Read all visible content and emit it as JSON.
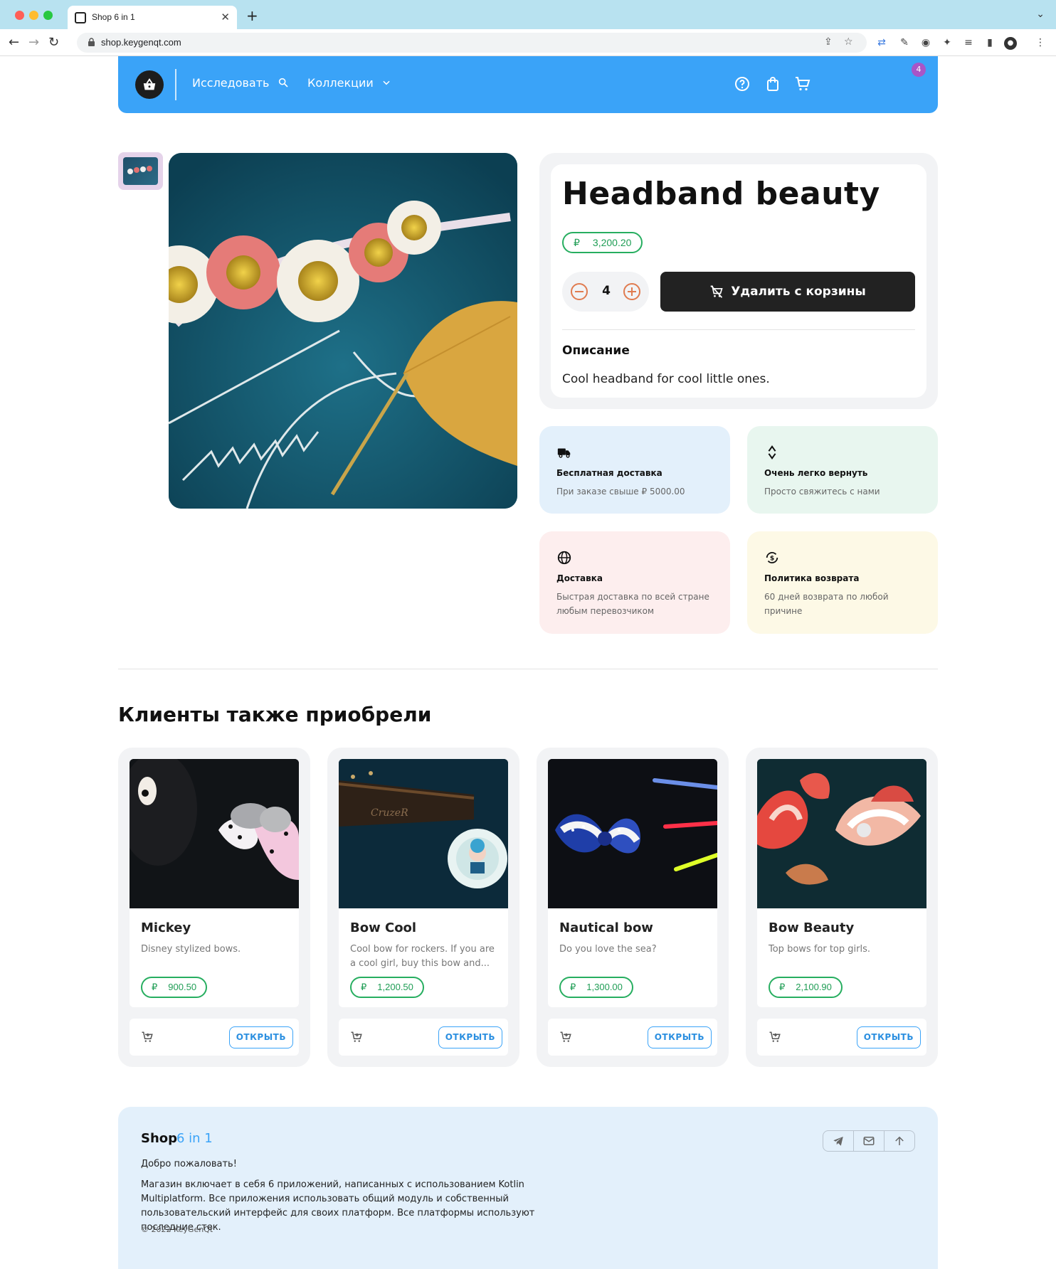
{
  "browser": {
    "tab_title": "Shop 6 in 1",
    "url": "shop.keygenqt.com"
  },
  "header": {
    "explore": "Исследовать",
    "collections": "Коллекции",
    "cart_count": "4",
    "accent": "#3aa3f8"
  },
  "product": {
    "title": "Headband beauty",
    "currency": "₽",
    "price": "3,200.20",
    "quantity": "4",
    "remove_label": "Удалить с корзины",
    "description_title": "Описание",
    "description": "Cool headband for cool little ones."
  },
  "features": [
    {
      "icon": "truck-icon",
      "title": "Бесплатная доставка",
      "text": "При заказе свыше ₽ 5000.00",
      "bg": "#e3f0fb"
    },
    {
      "icon": "recycle-icon",
      "title": "Очень легко вернуть",
      "text": "Просто свяжитесь с нами",
      "bg": "#e8f6ef"
    },
    {
      "icon": "globe-icon",
      "title": "Доставка",
      "text": "Быстрая доставка по всей стране любым перевозчиком",
      "bg": "#fdeeee"
    },
    {
      "icon": "currency-exchange-icon",
      "title": "Политика возврата",
      "text": "60 дней возврата по любой причине",
      "bg": "#fdf9e6"
    }
  ],
  "also_bought": {
    "title": "Клиенты также приобрели",
    "open_label": "ОТКРЫТЬ",
    "items": [
      {
        "name": "Mickey",
        "desc": "Disney stylized bows.",
        "price": "900.50"
      },
      {
        "name": "Bow Cool",
        "desc": "Cool bow for rockers. If you are a cool girl, buy this bow and...",
        "price": "1,200.50"
      },
      {
        "name": "Nautical bow",
        "desc": "Do you love the sea?",
        "price": "1,300.00"
      },
      {
        "name": "Bow Beauty",
        "desc": "Top bows for top girls.",
        "price": "2,100.90"
      }
    ]
  },
  "footer": {
    "brand": "Shop",
    "brand_sub": "6 in 1",
    "welcome": "Добро пожаловать!",
    "about": "Магазин включает в себя 6 приложений, написанных с использованием Kotlin Multiplatform. Все приложения использовать общий модуль и собственный пользовательский интерфейс для своих платформ. Все платформы используют последние стек.",
    "copyright": "© 2022 KeyGenQt"
  }
}
